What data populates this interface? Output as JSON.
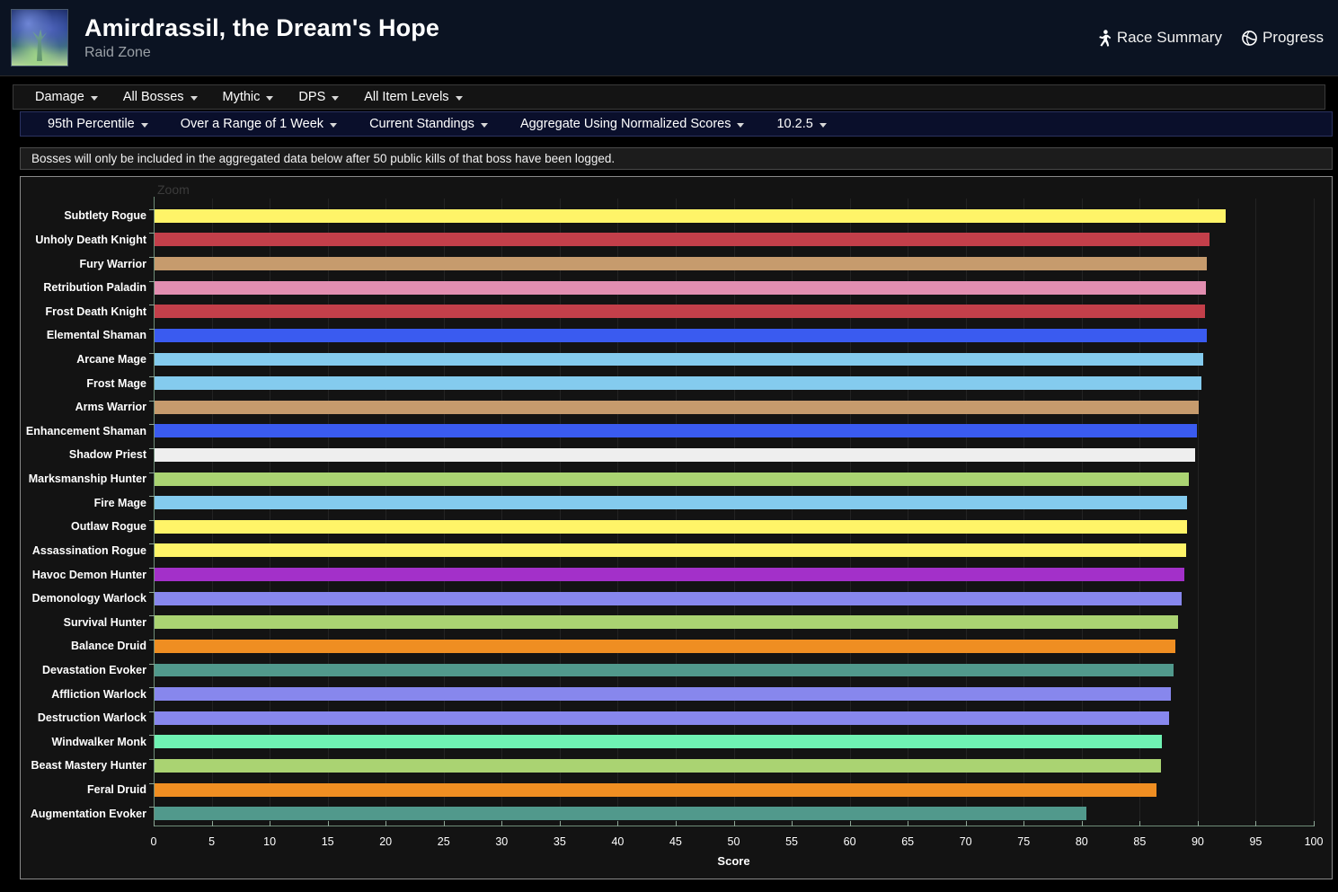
{
  "header": {
    "title": "Amirdrassil, the Dream's Hope",
    "subtitle": "Raid Zone",
    "zone_icon_name": "raid-zone-thumbnail",
    "links": [
      {
        "label": "Race Summary",
        "icon": "runner-icon"
      },
      {
        "label": "Progress",
        "icon": "globe-icon"
      }
    ]
  },
  "nav_primary": [
    {
      "label": "Damage"
    },
    {
      "label": "All Bosses"
    },
    {
      "label": "Mythic"
    },
    {
      "label": "DPS"
    },
    {
      "label": "All Item Levels"
    }
  ],
  "nav_secondary": [
    {
      "label": "95th Percentile"
    },
    {
      "label": "Over a Range of 1 Week"
    },
    {
      "label": "Current Standings"
    },
    {
      "label": "Aggregate Using Normalized Scores"
    },
    {
      "label": "10.2.5"
    }
  ],
  "notice": "Bosses will only be included in the aggregated data below after 50 public kills of that boss have been logged.",
  "chart": {
    "zoom_label": "Zoom"
  },
  "chart_data": {
    "type": "bar",
    "orientation": "horizontal",
    "title": "",
    "xlabel": "Score",
    "ylabel": "",
    "xlim": [
      0,
      100
    ],
    "xticks": [
      0,
      5,
      10,
      15,
      20,
      25,
      30,
      35,
      40,
      45,
      50,
      55,
      60,
      65,
      70,
      75,
      80,
      85,
      90,
      95,
      100
    ],
    "grid": true,
    "legend": "none",
    "categories": [
      "Subtlety Rogue",
      "Unholy Death Knight",
      "Fury Warrior",
      "Retribution Paladin",
      "Frost Death Knight",
      "Elemental Shaman",
      "Arcane Mage",
      "Frost Mage",
      "Arms Warrior",
      "Enhancement Shaman",
      "Shadow Priest",
      "Marksmanship Hunter",
      "Fire Mage",
      "Outlaw Rogue",
      "Assassination Rogue",
      "Havoc Demon Hunter",
      "Demonology Warlock",
      "Survival Hunter",
      "Balance Druid",
      "Devastation Evoker",
      "Affliction Warlock",
      "Destruction Warlock",
      "Windwalker Monk",
      "Beast Mastery Hunter",
      "Feral Druid",
      "Augmentation Evoker"
    ],
    "values": [
      92.4,
      91.0,
      90.8,
      90.7,
      90.6,
      90.8,
      90.5,
      90.3,
      90.1,
      89.9,
      89.8,
      89.2,
      89.1,
      89.1,
      89.0,
      88.8,
      88.6,
      88.3,
      88.1,
      87.9,
      87.7,
      87.5,
      86.9,
      86.8,
      86.4,
      80.4
    ],
    "colors": [
      "#fff468",
      "#c33f4a",
      "#c69b6d",
      "#e28eb0",
      "#c33f4a",
      "#3a5bf0",
      "#84cbee",
      "#84cbee",
      "#c69b6d",
      "#3a5bf0",
      "#eeeeee",
      "#aad372",
      "#84cbee",
      "#fff468",
      "#fff468",
      "#a330c9",
      "#8787ed",
      "#aad372",
      "#ef8e22",
      "#51998c",
      "#8787ed",
      "#8787ed",
      "#6ff2b3",
      "#aad372",
      "#ef8e22",
      "#51998c"
    ]
  }
}
